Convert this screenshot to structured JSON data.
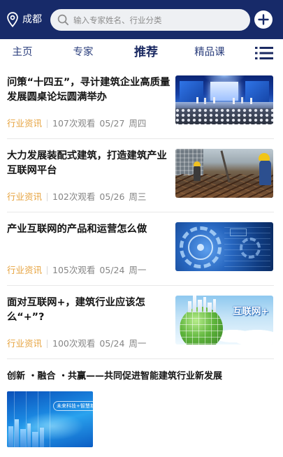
{
  "header": {
    "city": "成都",
    "location_icon": "location-pin-icon",
    "search": {
      "icon": "search-icon",
      "placeholder": "输入专家姓名、行业分类",
      "value": ""
    },
    "add_icon": "plus-circle-icon"
  },
  "tabs": {
    "items": [
      {
        "label": "主页",
        "active": false
      },
      {
        "label": "专家",
        "active": false
      },
      {
        "label": "推荐",
        "active": true
      },
      {
        "label": "精品课",
        "active": false
      }
    ],
    "menu_icon": "list-menu-icon"
  },
  "articles": [
    {
      "title": "问策“十四五”，寻计建筑企业高质量发展圆桌论坛圆满举办",
      "category": "行业资讯",
      "views": "107次观看",
      "date": "05/27",
      "weekday": "周四"
    },
    {
      "title": "大力发展装配式建筑，打造建筑产业互联网平台",
      "category": "行业资讯",
      "views": "102次观看",
      "date": "05/26",
      "weekday": "周三"
    },
    {
      "title": "产业互联网的产品和运营怎么做",
      "category": "行业资讯",
      "views": "105次观看",
      "date": "05/24",
      "weekday": "周一"
    },
    {
      "title": "面对互联网+，建筑行业应该怎么“+”?",
      "category": "行业资讯",
      "views": "100次观看",
      "date": "05/24",
      "weekday": "周一",
      "image_text": "互联网+"
    }
  ],
  "feature": {
    "title": "创新 ・融合 ・共赢——共同促进智能建筑行业新发展",
    "image_text": "未来科技+智慧城市"
  },
  "colors": {
    "brand": "#172a69",
    "tab": "#2d407e",
    "tab_active": "#1b2a62",
    "title": "#141414",
    "category": "#e6a23c",
    "meta": "#858585",
    "divider": "#e8e8e8"
  }
}
